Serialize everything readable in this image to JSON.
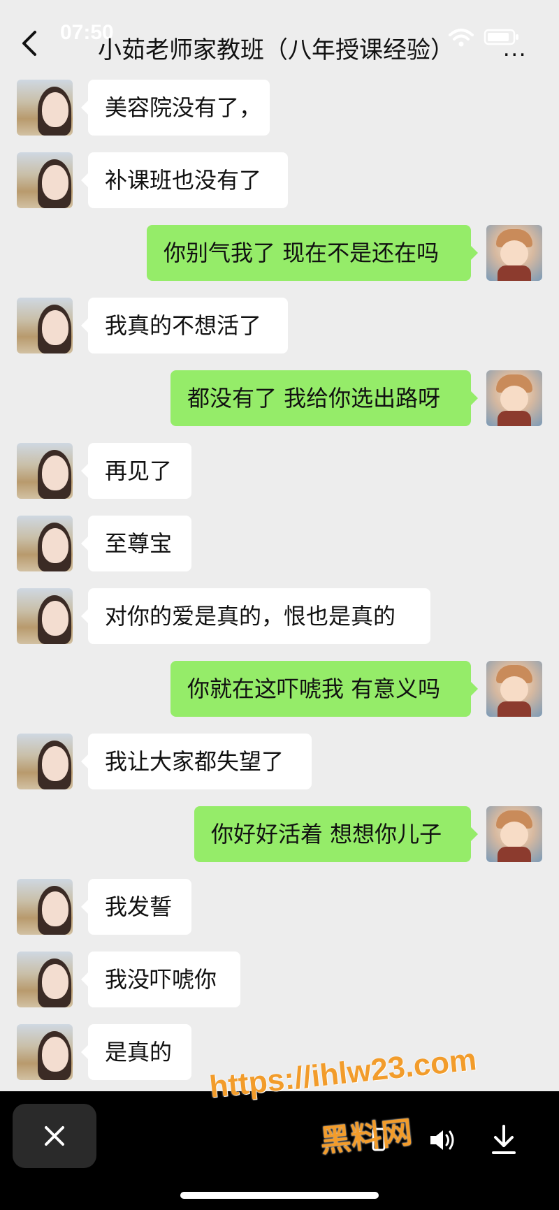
{
  "status_bar": {
    "time": "07:50"
  },
  "header": {
    "title": "小茹老师家教班（八年授课经验）",
    "more_label": "..."
  },
  "messages": [
    {
      "side": "in",
      "text": "美容院没有了，"
    },
    {
      "side": "in",
      "text": "补课班也没有了"
    },
    {
      "side": "out",
      "text": "你别气我了 现在不是还在吗"
    },
    {
      "side": "in",
      "text": "我真的不想活了"
    },
    {
      "side": "out",
      "text": "都没有了 我给你选出路呀"
    },
    {
      "side": "in",
      "text": "再见了"
    },
    {
      "side": "in",
      "text": "至尊宝"
    },
    {
      "side": "in",
      "text": "对你的爱是真的，恨也是真的"
    },
    {
      "side": "out",
      "text": "你就在这吓唬我 有意义吗"
    },
    {
      "side": "in",
      "text": "我让大家都失望了"
    },
    {
      "side": "out",
      "text": "你好好活着 想想你儿子"
    },
    {
      "side": "in",
      "text": "我发誓"
    },
    {
      "side": "in",
      "text": "我没吓唬你"
    },
    {
      "side": "in",
      "text": "是真的"
    }
  ],
  "watermark": {
    "url": "https://ihlw23.com",
    "name": "黑料网"
  },
  "colors": {
    "background": "#ededed",
    "incoming_bubble": "#ffffff",
    "outgoing_bubble": "#95ec69",
    "watermark": "#f29c2b"
  },
  "icons": [
    "back-icon",
    "wifi-icon",
    "battery-icon",
    "close-icon",
    "speaker-icon",
    "download-icon"
  ]
}
